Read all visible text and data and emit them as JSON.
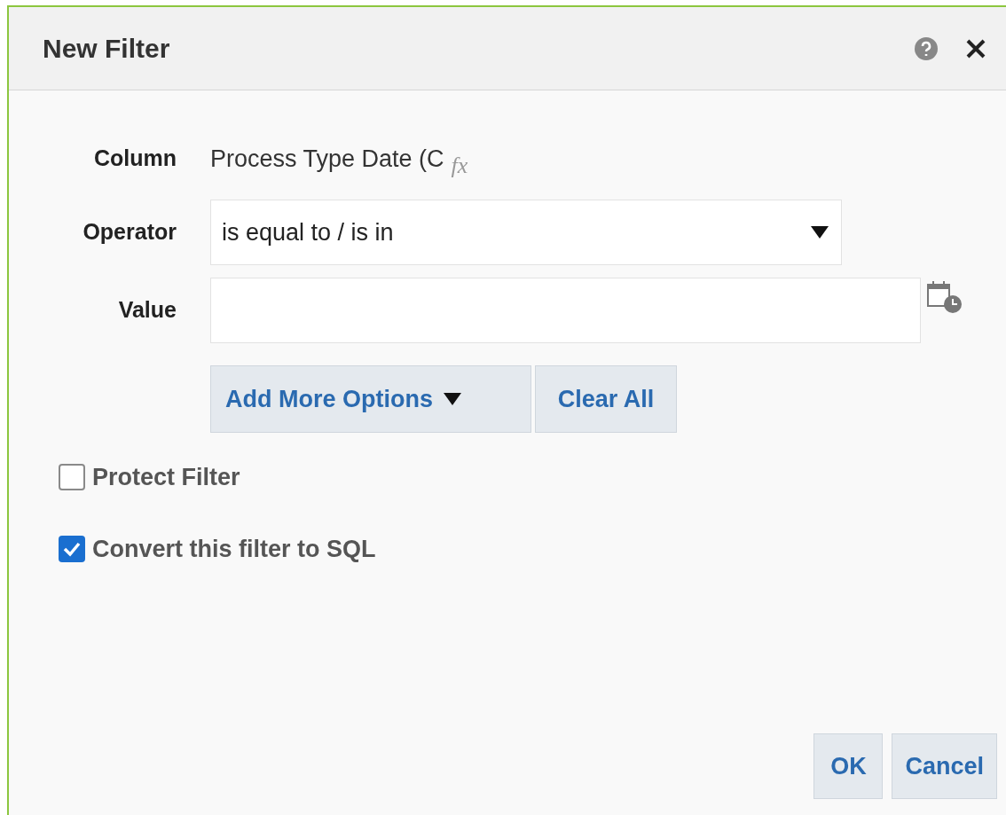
{
  "window": {
    "title": "New Filter"
  },
  "fields": [
    {
      "kind": "text",
      "label": "Column",
      "value": "Process Type Date (C",
      "formula": "fx"
    },
    {
      "kind": "select",
      "label": "Operator",
      "value": "is equal to / is in"
    },
    {
      "kind": "date",
      "label": "Value"
    }
  ],
  "value_buttons": [
    "Add More Options",
    "Clear All"
  ],
  "checkboxes": [
    {
      "label": "Protect Filter",
      "checked": false
    },
    {
      "label": "Convert this filter to SQL",
      "checked": true
    }
  ],
  "buttons": [
    "OK",
    "Cancel"
  ]
}
